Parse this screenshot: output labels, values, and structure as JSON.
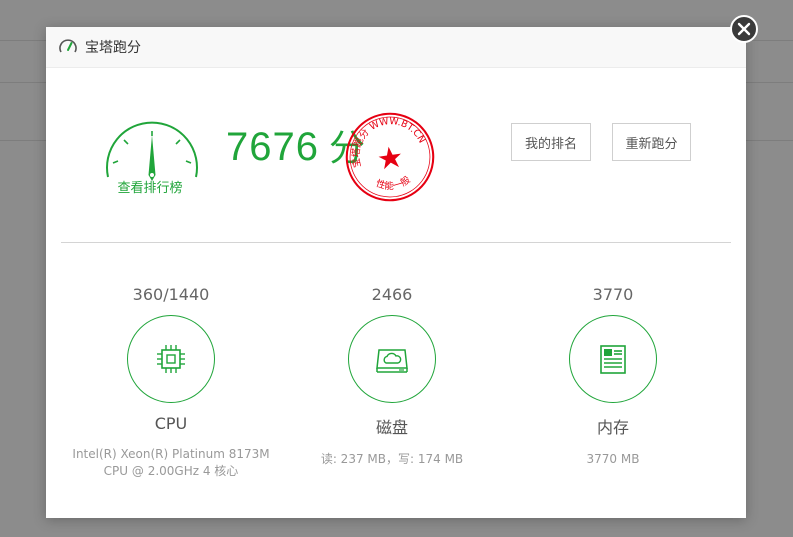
{
  "modal": {
    "title": "宝塔跑分",
    "gauge_label": "查看排行榜",
    "score": "7676",
    "score_unit": "分",
    "stamp": {
      "top_text": "宝塔跑分 WWW.BT.CN",
      "bottom_text": "性能一般",
      "color": "#e60012"
    },
    "buttons": {
      "my_rank": "我的排名",
      "rerun": "重新跑分"
    }
  },
  "metrics": [
    {
      "value": "360/1440",
      "name": "CPU",
      "detail": "Intel(R) Xeon(R) Platinum 8173M CPU @ 2.00GHz 4 核心",
      "icon": "cpu-icon"
    },
    {
      "value": "2466",
      "name": "磁盘",
      "detail": "读: 237 MB，写: 174 MB",
      "icon": "disk-icon"
    },
    {
      "value": "3770",
      "name": "内存",
      "detail": "3770 MB",
      "icon": "memory-icon"
    }
  ],
  "colors": {
    "accent": "#20a53a",
    "stamp": "#e60012"
  }
}
